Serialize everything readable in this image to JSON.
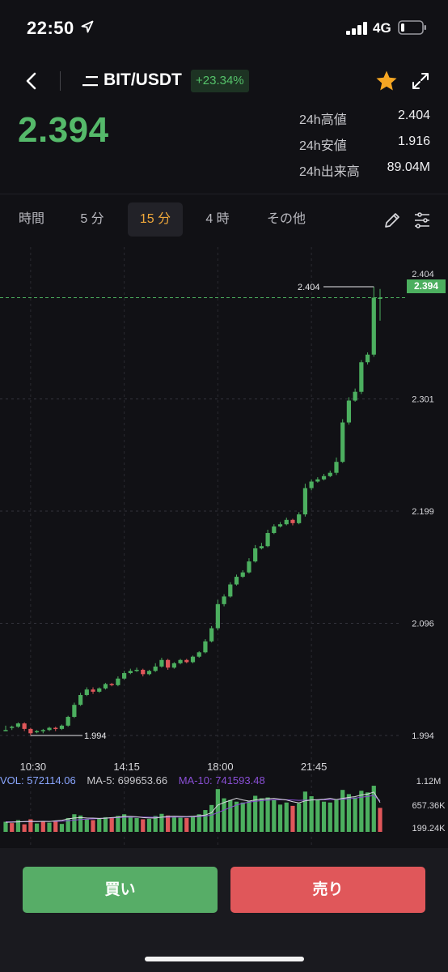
{
  "status_bar": {
    "time": "22:50",
    "network": "4G",
    "icons": [
      "location-arrow-icon",
      "signal-bars-icon",
      "battery-icon"
    ]
  },
  "header": {
    "pair": "BIT/USDT",
    "change": "+23.34%",
    "last_price": "2.394",
    "icons": [
      "back-chevron-icon",
      "menu-lines-icon",
      "star-icon",
      "expand-icon"
    ],
    "stats": [
      {
        "label": "24h高値",
        "value": "2.404"
      },
      {
        "label": "24h安値",
        "value": "1.916"
      },
      {
        "label": "24h出来高",
        "value": "89.04M"
      }
    ]
  },
  "tabs": {
    "items": [
      {
        "label": "時間",
        "active": false
      },
      {
        "label": "5 分",
        "active": false
      },
      {
        "label": "15 分",
        "active": true
      },
      {
        "label": "4 時",
        "active": false
      },
      {
        "label": "その他",
        "active": false
      }
    ],
    "icons": [
      "pencil-icon",
      "indicator-settings-icon"
    ]
  },
  "colors": {
    "up": "#4caf5f",
    "down": "#e0575a",
    "accent": "#f0a83a",
    "ma5": "#d8d8de",
    "ma10": "#8a4fd6",
    "background": "#111115"
  },
  "chart_data": {
    "type": "candlestick",
    "y_ticks": [
      "2.404",
      "2.301",
      "2.199",
      "2.096",
      "1.994"
    ],
    "ylim": [
      1.994,
      2.404
    ],
    "x_ticks": [
      "10:30",
      "14:15",
      "18:00",
      "21:45"
    ],
    "current_price": "2.394",
    "high_marker": "2.404",
    "low_marker": "1.994",
    "candles": [
      [
        1.999,
        1.999,
        2.003,
        1.998
      ],
      [
        2.001,
        2.002,
        2.003,
        1.999
      ],
      [
        2.002,
        2.005,
        2.006,
        2.001
      ],
      [
        2.005,
        2.0,
        2.006,
        1.998
      ],
      [
        2.0,
        1.996,
        2.001,
        1.994
      ],
      [
        1.997,
        1.998,
        1.999,
        1.996
      ],
      [
        1.998,
        1.999,
        2.0,
        1.996
      ],
      [
        1.999,
        2.001,
        2.002,
        1.998
      ],
      [
        2.001,
        2.0,
        2.002,
        1.998
      ],
      [
        2.0,
        2.003,
        2.004,
        1.999
      ],
      [
        2.003,
        2.011,
        2.012,
        2.002
      ],
      [
        2.011,
        2.022,
        2.024,
        2.01
      ],
      [
        2.022,
        2.031,
        2.033,
        2.021
      ],
      [
        2.031,
        2.036,
        2.038,
        2.03
      ],
      [
        2.036,
        2.034,
        2.038,
        2.032
      ],
      [
        2.034,
        2.037,
        2.038,
        2.033
      ],
      [
        2.037,
        2.041,
        2.042,
        2.036
      ],
      [
        2.041,
        2.04,
        2.042,
        2.039
      ],
      [
        2.04,
        2.046,
        2.048,
        2.039
      ],
      [
        2.046,
        2.051,
        2.053,
        2.045
      ],
      [
        2.051,
        2.053,
        2.055,
        2.05
      ],
      [
        2.053,
        2.054,
        2.056,
        2.052
      ],
      [
        2.054,
        2.05,
        2.055,
        2.048
      ],
      [
        2.05,
        2.053,
        2.054,
        2.049
      ],
      [
        2.053,
        2.057,
        2.06,
        2.052
      ],
      [
        2.057,
        2.063,
        2.065,
        2.056
      ],
      [
        2.063,
        2.056,
        2.064,
        2.054
      ],
      [
        2.056,
        2.06,
        2.061,
        2.055
      ],
      [
        2.06,
        2.063,
        2.064,
        2.059
      ],
      [
        2.063,
        2.061,
        2.064,
        2.06
      ],
      [
        2.061,
        2.066,
        2.067,
        2.06
      ],
      [
        2.066,
        2.07,
        2.071,
        2.065
      ],
      [
        2.07,
        2.08,
        2.082,
        2.069
      ],
      [
        2.08,
        2.092,
        2.094,
        2.079
      ],
      [
        2.092,
        2.114,
        2.118,
        2.09
      ],
      [
        2.114,
        2.121,
        2.123,
        2.112
      ],
      [
        2.121,
        2.132,
        2.134,
        2.12
      ],
      [
        2.132,
        2.139,
        2.141,
        2.131
      ],
      [
        2.139,
        2.143,
        2.145,
        2.138
      ],
      [
        2.143,
        2.153,
        2.156,
        2.142
      ],
      [
        2.153,
        2.165,
        2.168,
        2.152
      ],
      [
        2.165,
        2.167,
        2.17,
        2.164
      ],
      [
        2.167,
        2.179,
        2.182,
        2.166
      ],
      [
        2.179,
        2.185,
        2.187,
        2.178
      ],
      [
        2.185,
        2.187,
        2.189,
        2.184
      ],
      [
        2.187,
        2.191,
        2.193,
        2.186
      ],
      [
        2.191,
        2.188,
        2.192,
        2.186
      ],
      [
        2.188,
        2.196,
        2.198,
        2.187
      ],
      [
        2.196,
        2.22,
        2.224,
        2.194
      ],
      [
        2.22,
        2.226,
        2.228,
        2.218
      ],
      [
        2.226,
        2.228,
        2.23,
        2.225
      ],
      [
        2.228,
        2.231,
        2.233,
        2.227
      ],
      [
        2.231,
        2.234,
        2.236,
        2.23
      ],
      [
        2.234,
        2.244,
        2.248,
        2.232
      ],
      [
        2.244,
        2.28,
        2.283,
        2.243
      ],
      [
        2.28,
        2.3,
        2.303,
        2.278
      ],
      [
        2.3,
        2.308,
        2.311,
        2.299
      ],
      [
        2.308,
        2.335,
        2.337,
        2.306
      ],
      [
        2.335,
        2.342,
        2.344,
        2.333
      ],
      [
        2.342,
        2.394,
        2.404,
        2.34
      ],
      [
        2.394,
        2.394,
        2.402,
        2.373
      ]
    ],
    "volume": {
      "labels": {
        "vol": "VOL: 572114.06",
        "ma5": "MA-5: 699653.66",
        "ma10": "MA-10: 741593.48"
      },
      "y_ticks": [
        "1.12M",
        "657.36K",
        "199.24K"
      ],
      "ylim": [
        0,
        1120000
      ],
      "values": [
        240000,
        210000,
        280000,
        180000,
        300000,
        200000,
        250000,
        220000,
        260000,
        190000,
        330000,
        420000,
        390000,
        300000,
        280000,
        310000,
        350000,
        330000,
        380000,
        420000,
        360000,
        330000,
        300000,
        310000,
        380000,
        430000,
        390000,
        350000,
        340000,
        330000,
        380000,
        420000,
        520000,
        640000,
        1020000,
        800000,
        760000,
        720000,
        700000,
        740000,
        860000,
        800000,
        820000,
        760000,
        650000,
        700000,
        620000,
        680000,
        960000,
        850000,
        760000,
        720000,
        700000,
        760000,
        1000000,
        900000,
        820000,
        980000,
        940000,
        1100000,
        572114
      ],
      "ma5": [
        230000,
        232000,
        240000,
        246000,
        250000,
        246000,
        252000,
        246000,
        262000,
        276000,
        310000,
        330000,
        340000,
        330000,
        328000,
        320000,
        326000,
        340000,
        350000,
        370000,
        370000,
        360000,
        340000,
        330000,
        330000,
        350000,
        370000,
        374000,
        370000,
        365000,
        372000,
        384000,
        400000,
        460000,
        640000,
        700000,
        750000,
        800000,
        760000,
        735000,
        760000,
        780000,
        790000,
        800000,
        780000,
        760000,
        720000,
        690000,
        740000,
        760000,
        768000,
        778000,
        800000,
        770000,
        800000,
        820000,
        840000,
        880000,
        900000,
        950000,
        699654
      ],
      "ma10": [
        240000,
        238000,
        240000,
        242000,
        244000,
        246000,
        248000,
        250000,
        252000,
        255000,
        265000,
        280000,
        295000,
        305000,
        312000,
        318000,
        325000,
        332000,
        340000,
        350000,
        352000,
        354000,
        352000,
        350000,
        348000,
        348000,
        350000,
        352000,
        354000,
        356000,
        360000,
        366000,
        378000,
        400000,
        460000,
        520000,
        580000,
        640000,
        680000,
        710000,
        730000,
        745000,
        755000,
        765000,
        770000,
        765000,
        760000,
        750000,
        755000,
        760000,
        762000,
        765000,
        770000,
        772000,
        780000,
        790000,
        805000,
        825000,
        845000,
        870000,
        741593
      ],
      "colors": [
        "up",
        "down",
        "up",
        "down",
        "down",
        "up",
        "down",
        "up",
        "down",
        "up",
        "up",
        "up",
        "up",
        "up",
        "down",
        "up",
        "up",
        "down",
        "up",
        "up",
        "up",
        "up",
        "down",
        "up",
        "up",
        "up",
        "down",
        "up",
        "up",
        "down",
        "up",
        "up",
        "up",
        "up",
        "up",
        "up",
        "up",
        "up",
        "up",
        "up",
        "up",
        "up",
        "up",
        "up",
        "up",
        "up",
        "down",
        "up",
        "up",
        "up",
        "up",
        "up",
        "up",
        "up",
        "up",
        "up",
        "up",
        "up",
        "up",
        "up",
        "down"
      ]
    }
  },
  "actions": {
    "buy": "買い",
    "sell": "売り"
  }
}
